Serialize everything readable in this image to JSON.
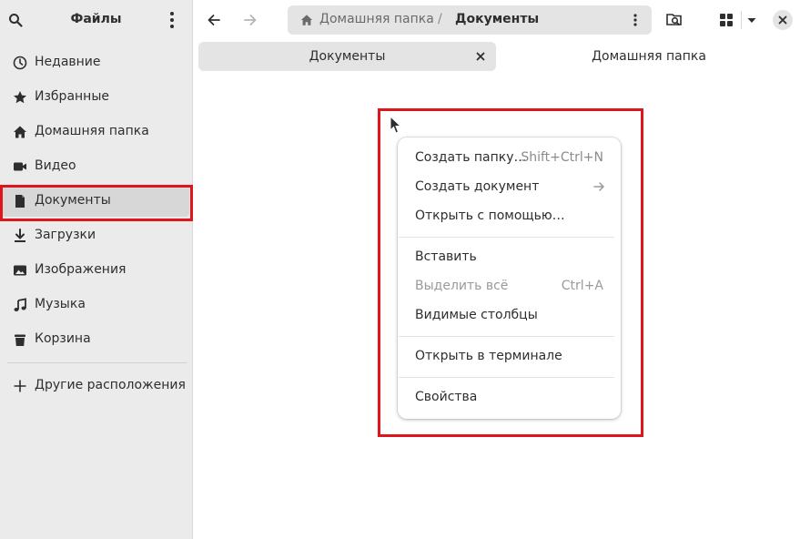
{
  "sidebar": {
    "title": "Файлы",
    "items": [
      {
        "label": "Недавние",
        "icon": "clock-icon"
      },
      {
        "label": "Избранные",
        "icon": "star-icon"
      },
      {
        "label": "Домашняя папка",
        "icon": "home-icon"
      },
      {
        "label": "Видео",
        "icon": "video-icon"
      },
      {
        "label": "Документы",
        "icon": "document-icon"
      },
      {
        "label": "Загрузки",
        "icon": "download-icon"
      },
      {
        "label": "Изображения",
        "icon": "image-icon"
      },
      {
        "label": "Музыка",
        "icon": "music-icon"
      },
      {
        "label": "Корзина",
        "icon": "trash-icon"
      }
    ],
    "other_locations": "Другие расположения",
    "active_item": "Документы"
  },
  "pathbar": {
    "home": "Домашняя папка",
    "separator": "/",
    "current": "Документы"
  },
  "tabs": [
    {
      "label": "Документы",
      "active": true
    },
    {
      "label": "Домашняя папка",
      "active": false
    }
  ],
  "context_menu": {
    "items": [
      {
        "label": "Создать папку…",
        "accel": "Shift+Ctrl+N"
      },
      {
        "label": "Создать документ",
        "submenu": true
      },
      {
        "label": "Открыть с помощью…"
      },
      {
        "label": "Вставить"
      },
      {
        "label": "Выделить всё",
        "accel": "Ctrl+A",
        "disabled": true
      },
      {
        "label": "Видимые столбцы"
      },
      {
        "label": "Открыть в терминале"
      },
      {
        "label": "Свойства"
      }
    ]
  },
  "colors": {
    "highlight": "#e0141b",
    "sidebar_bg": "#ebebeb",
    "active_bg": "#d7d7d7"
  }
}
